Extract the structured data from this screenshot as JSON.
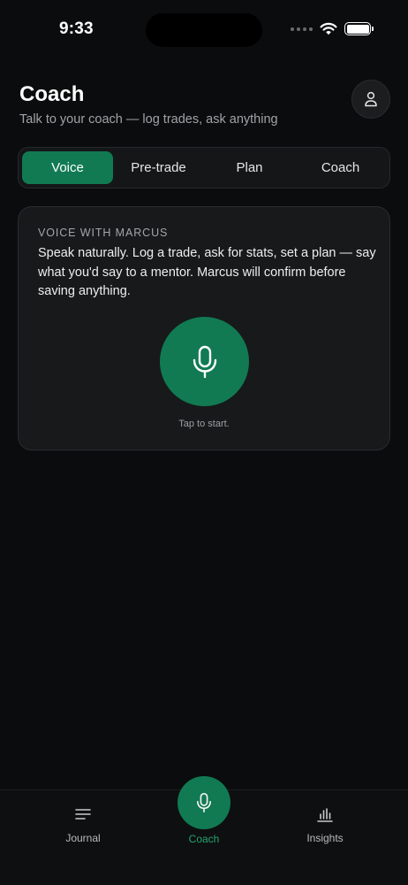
{
  "status_bar": {
    "time": "9:33"
  },
  "header": {
    "title": "Coach",
    "subtitle": "Talk to your coach — log trades, ask anything",
    "profile_icon": "person-icon"
  },
  "tabs": [
    {
      "label": "Voice",
      "active": true
    },
    {
      "label": "Pre-trade",
      "active": false
    },
    {
      "label": "Plan",
      "active": false
    },
    {
      "label": "Coach",
      "active": false
    }
  ],
  "voice_card": {
    "kicker": "VOICE WITH MARCUS",
    "body": "Speak naturally. Log a trade, ask for stats, set a plan — say what you'd say to a mentor. Marcus will confirm before saving anything.",
    "mic_icon": "microphone-icon",
    "hint": "Tap to start."
  },
  "bottom_nav": [
    {
      "label": "Journal",
      "icon": "lines-icon"
    },
    {
      "label": "Coach",
      "icon": "microphone-icon",
      "active": true
    },
    {
      "label": "Insights",
      "icon": "bar-chart-icon"
    }
  ],
  "colors": {
    "background": "#0b0c0d",
    "accent": "#117a52",
    "accent_text": "#23a56f",
    "card": "#17191b"
  }
}
